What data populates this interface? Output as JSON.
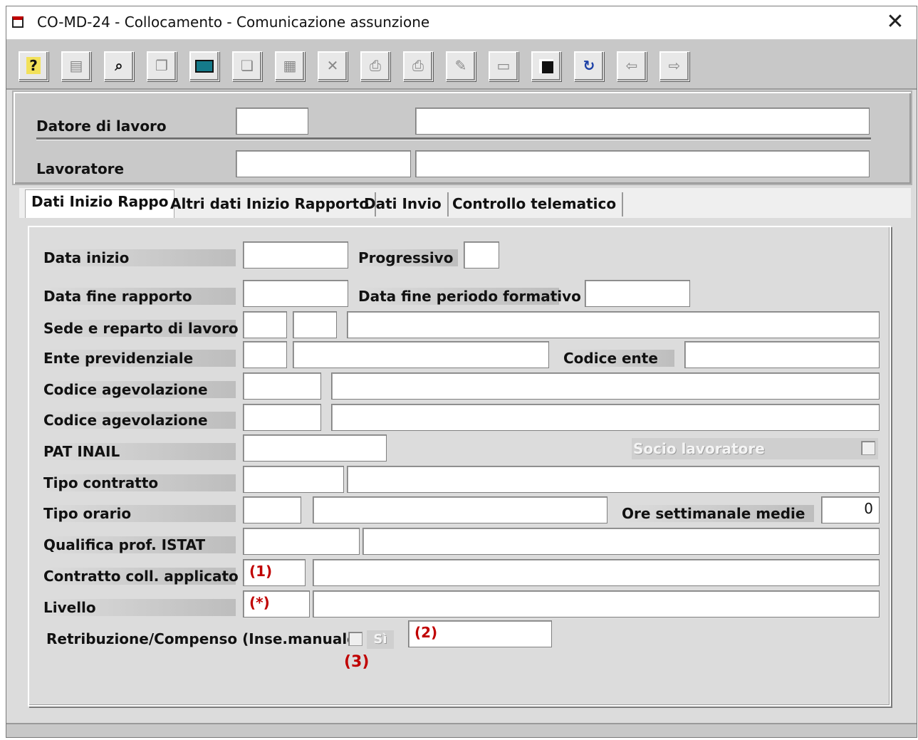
{
  "window": {
    "title": "CO-MD-24 - Collocamento - Comunicazione assunzione",
    "close_glyph": "✕"
  },
  "toolbar": {
    "buttons": [
      {
        "name": "help-button",
        "icon": "question-icon",
        "glyph": "?"
      },
      {
        "name": "properties-button",
        "icon": "properties-icon",
        "glyph": "▤"
      },
      {
        "name": "search-button",
        "icon": "binoculars-icon",
        "glyph": "⌕"
      },
      {
        "name": "copy-button",
        "icon": "copy-icon",
        "glyph": "❐"
      },
      {
        "name": "display-button",
        "icon": "monitor-icon",
        "glyph": "▭"
      },
      {
        "name": "duplicate-button",
        "icon": "duplicate-icon",
        "glyph": "❏"
      },
      {
        "name": "grid-button",
        "icon": "grid-icon",
        "glyph": "▦"
      },
      {
        "name": "delete-button",
        "icon": "delete-icon",
        "glyph": "✕"
      },
      {
        "name": "preview-button",
        "icon": "preview-icon",
        "glyph": "⎙"
      },
      {
        "name": "print-button",
        "icon": "printer-icon",
        "glyph": "⎙"
      },
      {
        "name": "edit-button",
        "icon": "edit-icon",
        "glyph": "✎"
      },
      {
        "name": "form-button",
        "icon": "form-icon",
        "glyph": "▭"
      },
      {
        "name": "save-button",
        "icon": "floppy-disk-icon",
        "glyph": "▣"
      },
      {
        "name": "refresh-button",
        "icon": "refresh-icon",
        "glyph": "↻"
      },
      {
        "name": "back-button",
        "icon": "arrow-left-icon",
        "glyph": "⇦"
      },
      {
        "name": "forward-button",
        "icon": "arrow-right-icon",
        "glyph": "⇨"
      }
    ]
  },
  "header": {
    "employer_label": "Datore di lavoro",
    "worker_label": "Lavoratore"
  },
  "tabs": [
    {
      "label": "Dati Inizio Rappo"
    },
    {
      "label": "Altri dati Inizio Rapporto"
    },
    {
      "label": "Dati Invio"
    },
    {
      "label": "Controllo telematico"
    }
  ],
  "form": {
    "data_inizio": "Data inizio",
    "progressivo": "Progressivo",
    "data_fine_rapporto": "Data fine rapporto",
    "data_fine_periodo_formativo": "Data fine periodo formativo",
    "sede_reparto": "Sede e reparto di lavoro",
    "ente_previdenziale": "Ente previdenziale",
    "codice_ente": "Codice ente",
    "codice_agevolazione_1": "Codice agevolazione",
    "codice_agevolazione_2": "Codice agevolazione",
    "pat_inail": "PAT INAIL",
    "socio_lavoratore": "Socio lavoratore",
    "tipo_contratto": "Tipo contratto",
    "tipo_orario": "Tipo orario",
    "ore_settimanale_medie": "Ore settimanale medie",
    "ore_value": "0",
    "qualifica_istat": "Qualifica prof. ISTAT",
    "contratto_coll": "Contratto coll. applicato",
    "contratto_note": "(1)",
    "livello": "Livello",
    "livello_note": "(*)",
    "retribuzione": "Retribuzione/Compenso (Inse.manuale)",
    "si_label": "Sì",
    "retribuzione_note": "(2)",
    "checkbox_note": "(3)"
  }
}
